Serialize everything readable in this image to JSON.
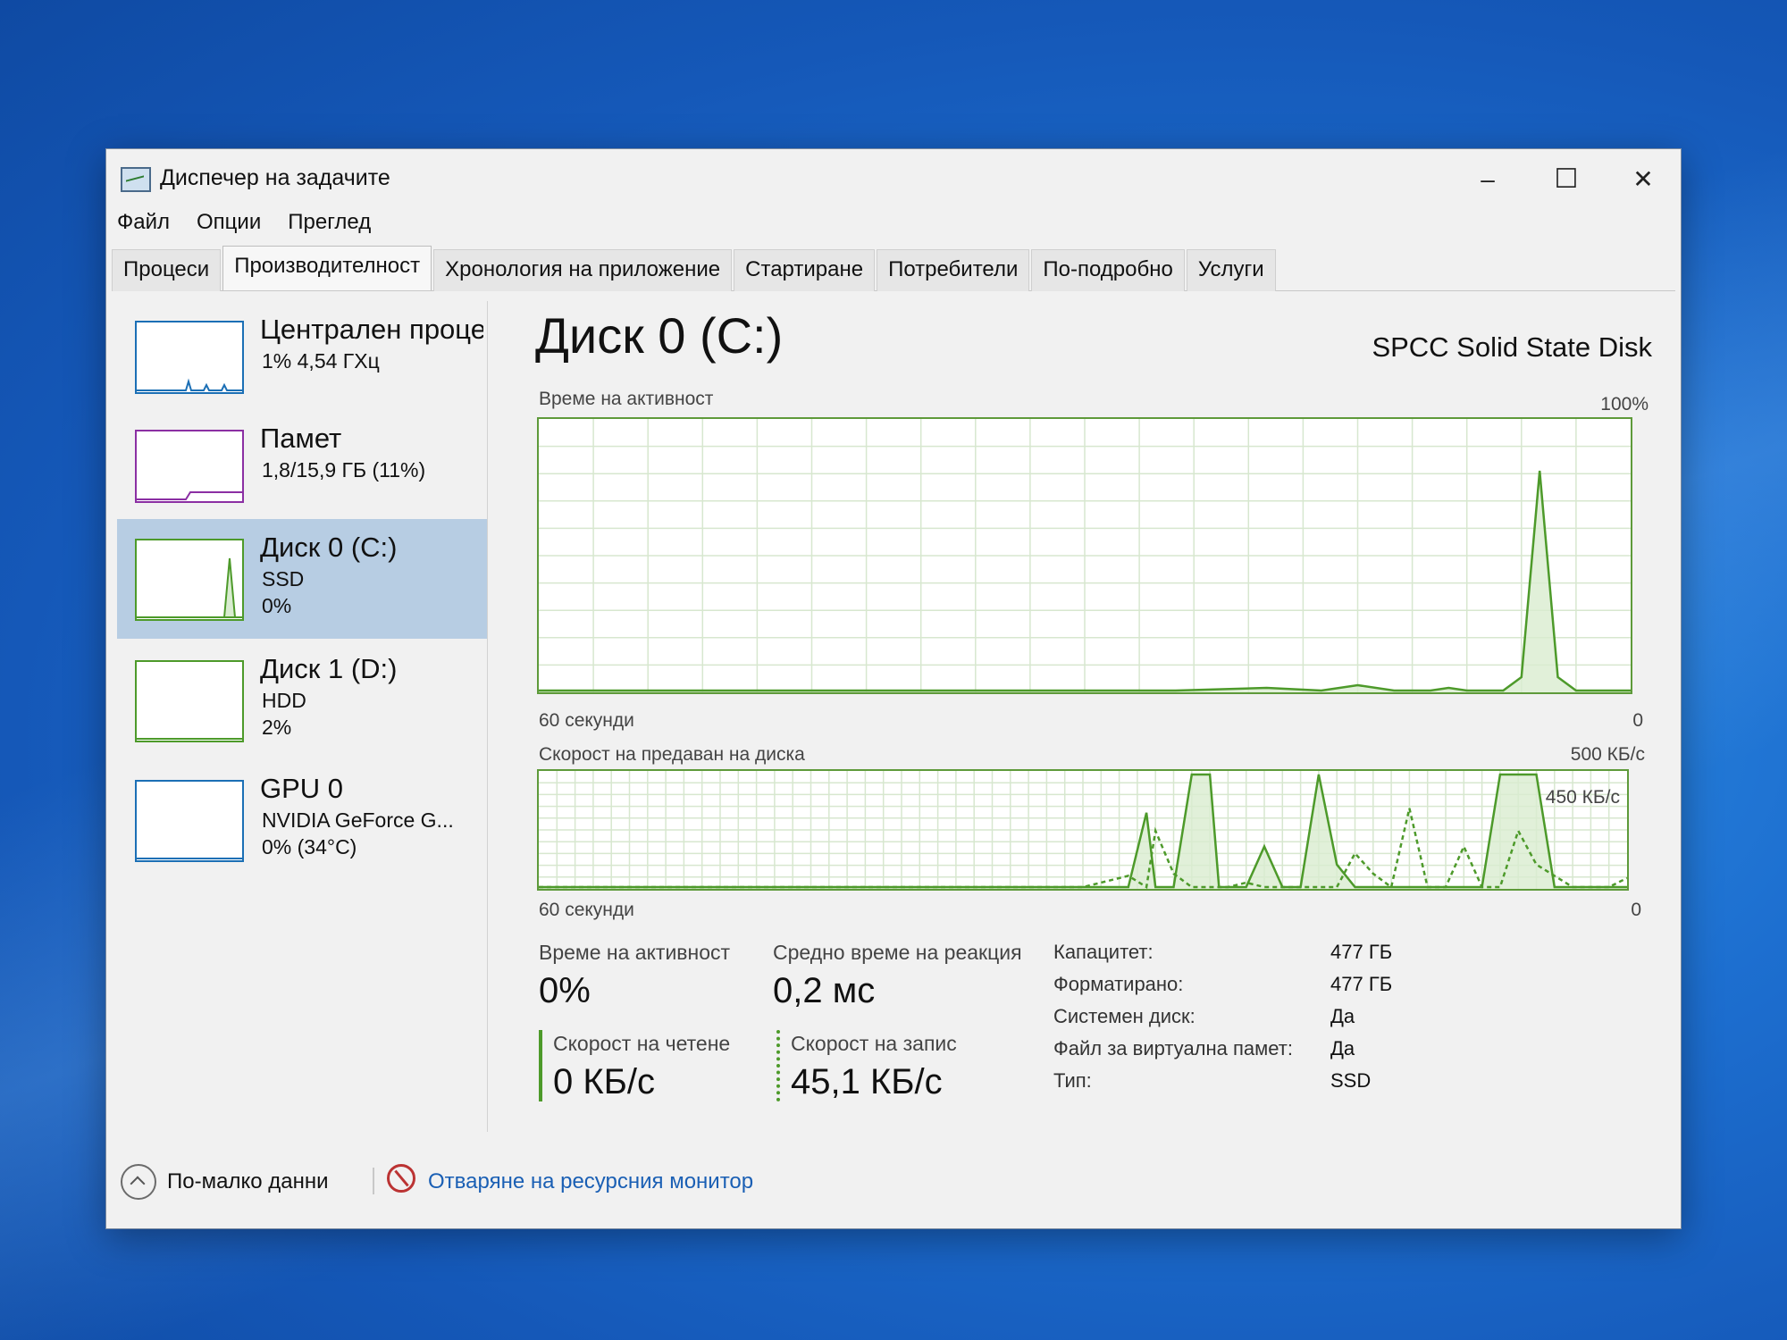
{
  "window": {
    "title": "Диспечер на задачите",
    "minimize": "–",
    "maximize": "☐",
    "close": "✕"
  },
  "menu": [
    "Файл",
    "Опции",
    "Преглед"
  ],
  "tabs": [
    {
      "label": "Процеси"
    },
    {
      "label": "Производителност"
    },
    {
      "label": "Хронология на приложение"
    },
    {
      "label": "Стартиране"
    },
    {
      "label": "Потребители"
    },
    {
      "label": "По-подробно"
    },
    {
      "label": "Услуги"
    }
  ],
  "active_tab": "Производителност",
  "sidebar": [
    {
      "title": "Централен проце",
      "sub1": "1% 4,54 ГХц",
      "sub2": "",
      "color": "#1b6fb5"
    },
    {
      "title": "Памет",
      "sub1": "1,8/15,9 ГБ (11%)",
      "sub2": "",
      "color": "#8b2fa3"
    },
    {
      "title": "Диск 0 (C:)",
      "sub1": "SSD",
      "sub2": "0%",
      "color": "#4d9a2a"
    },
    {
      "title": "Диск 1 (D:)",
      "sub1": "HDD",
      "sub2": "2%",
      "color": "#4d9a2a"
    },
    {
      "title": "GPU 0",
      "sub1": "NVIDIA GeForce G...",
      "sub2": "0% (34°C)",
      "color": "#1b6fb5"
    }
  ],
  "selected_sidebar": "Диск 0 (C:)",
  "main": {
    "title": "Диск 0 (C:)",
    "model": "SPCC Solid State Disk",
    "graph1": {
      "label": "Време на активност",
      "max_label": "100%",
      "xleft": "60 секунди",
      "xright": "0"
    },
    "graph2": {
      "label": "Скорост на предаван на диска",
      "max_label": "500 КБ/с",
      "ref_label": "450 КБ/с",
      "xleft": "60 секунди",
      "xright": "0"
    },
    "stats": {
      "active_label": "Време на активност",
      "active_value": "0%",
      "resp_label": "Средно време на реакция",
      "resp_value": "0,2 мс",
      "read_label": "Скорост на четене",
      "read_value": "0 КБ/с",
      "write_label": "Скорост на запис",
      "write_value": "45,1 КБ/с"
    },
    "props": [
      {
        "k": "Капацитет:",
        "v": "477 ГБ"
      },
      {
        "k": "Форматирано:",
        "v": "477 ГБ"
      },
      {
        "k": "Системен диск:",
        "v": "Да"
      },
      {
        "k": "Файл за виртуална памет:",
        "v": "Да"
      },
      {
        "k": "Тип:",
        "v": "SSD"
      }
    ]
  },
  "footer": {
    "less": "По-малко данни",
    "resmon": "Отваряне на ресурсния монитор"
  },
  "colors": {
    "graph_line": "#4d9a2a",
    "graph_fill": "#d9ecd0",
    "link": "#1a5fb4"
  },
  "chart_data": [
    {
      "type": "area",
      "title": "Време на активност",
      "xlabel": "60 секунди",
      "ylim": [
        0,
        100
      ],
      "x": [
        60,
        55,
        50,
        45,
        40,
        35,
        30,
        25,
        20,
        17,
        15,
        13,
        11,
        10,
        9,
        8,
        7,
        6,
        5,
        4,
        3,
        0
      ],
      "series": [
        {
          "values": [
            0,
            0,
            0,
            0,
            0,
            0,
            0,
            0,
            1,
            0,
            2,
            0,
            0,
            1,
            0,
            0,
            0,
            5,
            82,
            5,
            0,
            0
          ]
        }
      ]
    },
    {
      "type": "area",
      "title": "Скорост на предаван на диска",
      "xlabel": "60 секунди",
      "ylim": [
        0,
        500
      ],
      "x": [
        60,
        30,
        27.5,
        26.5,
        26,
        25,
        24,
        23,
        22.5,
        22,
        21,
        20,
        19,
        18,
        17,
        16,
        15,
        14,
        13,
        12,
        11,
        10,
        9,
        8,
        7,
        6,
        5,
        4,
        3,
        2,
        1,
        0
      ],
      "series": [
        {
          "values": [
            0,
            0,
            0,
            330,
            0,
            0,
            500,
            500,
            0,
            0,
            0,
            180,
            0,
            0,
            500,
            100,
            0,
            0,
            0,
            0,
            0,
            0,
            0,
            0,
            500,
            500,
            500,
            0,
            0,
            0,
            0,
            0
          ]
        },
        {
          "values": [
            0,
            0,
            50,
            0,
            250,
            60,
            0,
            0,
            0,
            0,
            20,
            0,
            0,
            0,
            0,
            0,
            150,
            60,
            0,
            350,
            0,
            0,
            180,
            0,
            0,
            250,
            100,
            50,
            0,
            0,
            0,
            40
          ]
        }
      ]
    }
  ]
}
